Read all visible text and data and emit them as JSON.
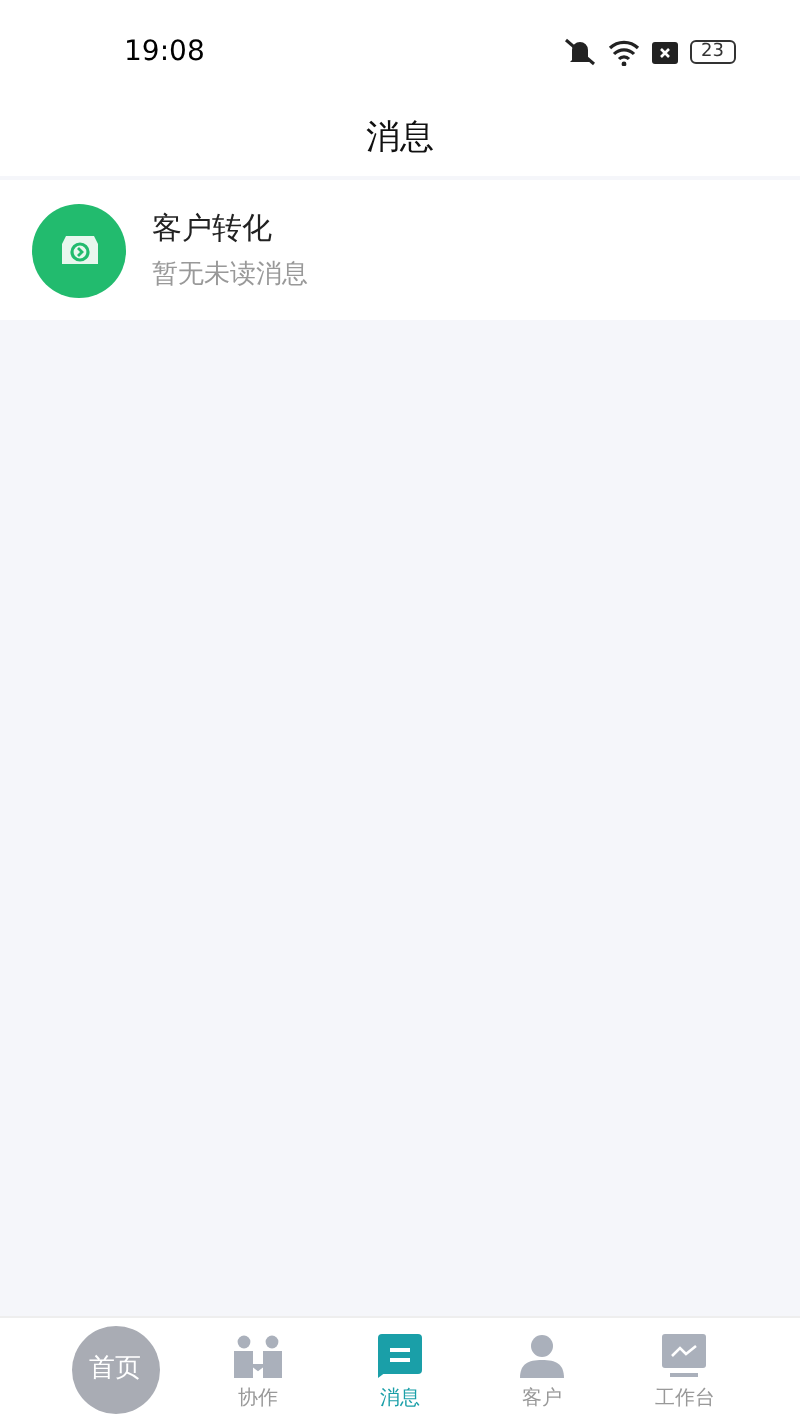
{
  "status_bar": {
    "time": "19:08",
    "battery": "23"
  },
  "header": {
    "title": "消息"
  },
  "conversations": [
    {
      "name": "客户转化",
      "preview": "暂无未读消息"
    }
  ],
  "tab_bar": [
    {
      "kind": "circle",
      "label": "首页",
      "selected": false
    },
    {
      "kind": "people",
      "label": "协作",
      "selected": false
    },
    {
      "kind": "chat",
      "label": "消息",
      "selected": true
    },
    {
      "kind": "person",
      "label": "客户",
      "selected": false
    },
    {
      "kind": "chart",
      "label": "工作台",
      "selected": false
    }
  ]
}
